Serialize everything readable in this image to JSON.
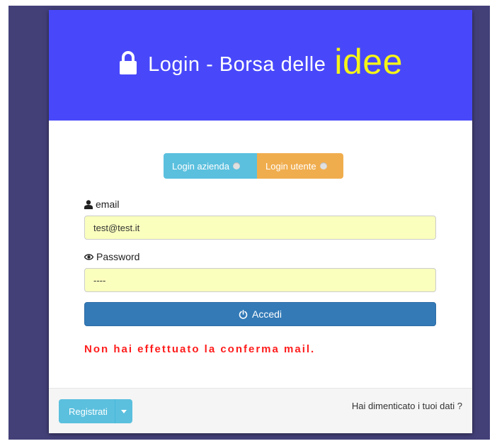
{
  "header": {
    "title": "Login - Borsa delle",
    "title_accent": "idee",
    "background_color": "#4848fa",
    "accent_color": "#f4f41a",
    "icon": "lock-icon"
  },
  "account_type": {
    "options": [
      {
        "label": "Login azienda",
        "selected": false,
        "color": "#5bc0de"
      },
      {
        "label": "Login utente",
        "selected": true,
        "color": "#f0ad4e"
      }
    ]
  },
  "form": {
    "email_label": "email",
    "email_value": "test@test.it",
    "password_label": "Password",
    "password_value": "----",
    "submit_label": "Accedi"
  },
  "error_message": "Non hai effettuato la conferma mail.",
  "footer": {
    "register_label": "Registrati",
    "forgot_label": "Hai dimenticato i tuoi dati ?"
  }
}
